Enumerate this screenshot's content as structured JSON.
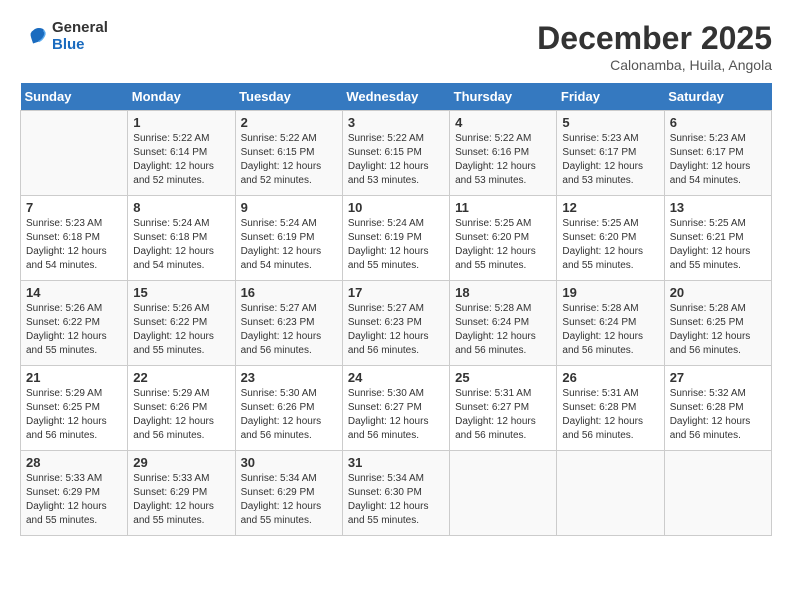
{
  "header": {
    "logo_general": "General",
    "logo_blue": "Blue",
    "month": "December 2025",
    "location": "Calonamba, Huila, Angola"
  },
  "days_of_week": [
    "Sunday",
    "Monday",
    "Tuesday",
    "Wednesday",
    "Thursday",
    "Friday",
    "Saturday"
  ],
  "weeks": [
    [
      {
        "num": "",
        "info": ""
      },
      {
        "num": "1",
        "info": "Sunrise: 5:22 AM\nSunset: 6:14 PM\nDaylight: 12 hours\nand 52 minutes."
      },
      {
        "num": "2",
        "info": "Sunrise: 5:22 AM\nSunset: 6:15 PM\nDaylight: 12 hours\nand 52 minutes."
      },
      {
        "num": "3",
        "info": "Sunrise: 5:22 AM\nSunset: 6:15 PM\nDaylight: 12 hours\nand 53 minutes."
      },
      {
        "num": "4",
        "info": "Sunrise: 5:22 AM\nSunset: 6:16 PM\nDaylight: 12 hours\nand 53 minutes."
      },
      {
        "num": "5",
        "info": "Sunrise: 5:23 AM\nSunset: 6:17 PM\nDaylight: 12 hours\nand 53 minutes."
      },
      {
        "num": "6",
        "info": "Sunrise: 5:23 AM\nSunset: 6:17 PM\nDaylight: 12 hours\nand 54 minutes."
      }
    ],
    [
      {
        "num": "7",
        "info": "Sunrise: 5:23 AM\nSunset: 6:18 PM\nDaylight: 12 hours\nand 54 minutes."
      },
      {
        "num": "8",
        "info": "Sunrise: 5:24 AM\nSunset: 6:18 PM\nDaylight: 12 hours\nand 54 minutes."
      },
      {
        "num": "9",
        "info": "Sunrise: 5:24 AM\nSunset: 6:19 PM\nDaylight: 12 hours\nand 54 minutes."
      },
      {
        "num": "10",
        "info": "Sunrise: 5:24 AM\nSunset: 6:19 PM\nDaylight: 12 hours\nand 55 minutes."
      },
      {
        "num": "11",
        "info": "Sunrise: 5:25 AM\nSunset: 6:20 PM\nDaylight: 12 hours\nand 55 minutes."
      },
      {
        "num": "12",
        "info": "Sunrise: 5:25 AM\nSunset: 6:20 PM\nDaylight: 12 hours\nand 55 minutes."
      },
      {
        "num": "13",
        "info": "Sunrise: 5:25 AM\nSunset: 6:21 PM\nDaylight: 12 hours\nand 55 minutes."
      }
    ],
    [
      {
        "num": "14",
        "info": "Sunrise: 5:26 AM\nSunset: 6:22 PM\nDaylight: 12 hours\nand 55 minutes."
      },
      {
        "num": "15",
        "info": "Sunrise: 5:26 AM\nSunset: 6:22 PM\nDaylight: 12 hours\nand 55 minutes."
      },
      {
        "num": "16",
        "info": "Sunrise: 5:27 AM\nSunset: 6:23 PM\nDaylight: 12 hours\nand 56 minutes."
      },
      {
        "num": "17",
        "info": "Sunrise: 5:27 AM\nSunset: 6:23 PM\nDaylight: 12 hours\nand 56 minutes."
      },
      {
        "num": "18",
        "info": "Sunrise: 5:28 AM\nSunset: 6:24 PM\nDaylight: 12 hours\nand 56 minutes."
      },
      {
        "num": "19",
        "info": "Sunrise: 5:28 AM\nSunset: 6:24 PM\nDaylight: 12 hours\nand 56 minutes."
      },
      {
        "num": "20",
        "info": "Sunrise: 5:28 AM\nSunset: 6:25 PM\nDaylight: 12 hours\nand 56 minutes."
      }
    ],
    [
      {
        "num": "21",
        "info": "Sunrise: 5:29 AM\nSunset: 6:25 PM\nDaylight: 12 hours\nand 56 minutes."
      },
      {
        "num": "22",
        "info": "Sunrise: 5:29 AM\nSunset: 6:26 PM\nDaylight: 12 hours\nand 56 minutes."
      },
      {
        "num": "23",
        "info": "Sunrise: 5:30 AM\nSunset: 6:26 PM\nDaylight: 12 hours\nand 56 minutes."
      },
      {
        "num": "24",
        "info": "Sunrise: 5:30 AM\nSunset: 6:27 PM\nDaylight: 12 hours\nand 56 minutes."
      },
      {
        "num": "25",
        "info": "Sunrise: 5:31 AM\nSunset: 6:27 PM\nDaylight: 12 hours\nand 56 minutes."
      },
      {
        "num": "26",
        "info": "Sunrise: 5:31 AM\nSunset: 6:28 PM\nDaylight: 12 hours\nand 56 minutes."
      },
      {
        "num": "27",
        "info": "Sunrise: 5:32 AM\nSunset: 6:28 PM\nDaylight: 12 hours\nand 56 minutes."
      }
    ],
    [
      {
        "num": "28",
        "info": "Sunrise: 5:33 AM\nSunset: 6:29 PM\nDaylight: 12 hours\nand 55 minutes."
      },
      {
        "num": "29",
        "info": "Sunrise: 5:33 AM\nSunset: 6:29 PM\nDaylight: 12 hours\nand 55 minutes."
      },
      {
        "num": "30",
        "info": "Sunrise: 5:34 AM\nSunset: 6:29 PM\nDaylight: 12 hours\nand 55 minutes."
      },
      {
        "num": "31",
        "info": "Sunrise: 5:34 AM\nSunset: 6:30 PM\nDaylight: 12 hours\nand 55 minutes."
      },
      {
        "num": "",
        "info": ""
      },
      {
        "num": "",
        "info": ""
      },
      {
        "num": "",
        "info": ""
      }
    ]
  ]
}
